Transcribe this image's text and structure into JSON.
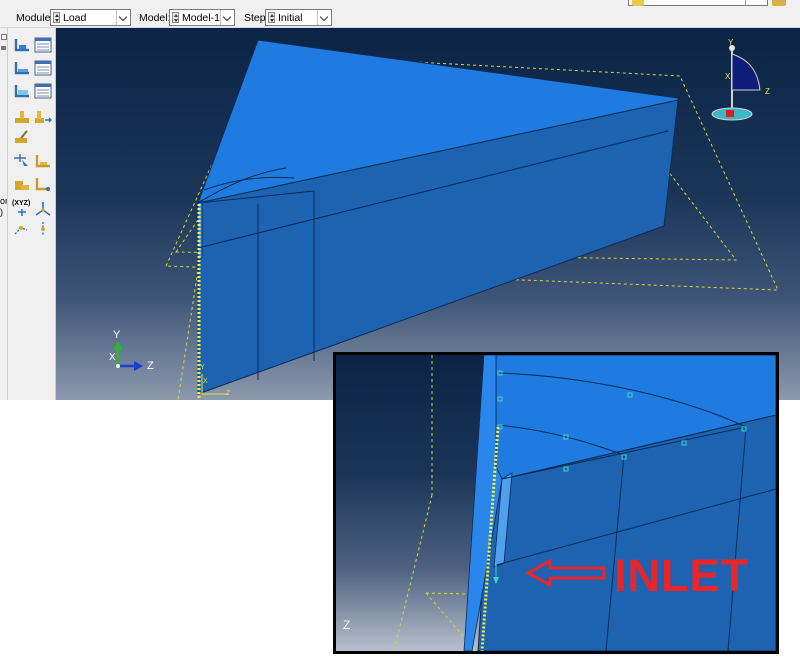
{
  "context_bar": {
    "module": {
      "label": "Module:",
      "value": "Load"
    },
    "model": {
      "label": "Model:",
      "value": "Model-1"
    },
    "step": {
      "label": "Step:",
      "value": "Initial"
    }
  },
  "left_strip_fragments": [
    "or",
    ")"
  ],
  "toolbox": {
    "xyz_tool_label": "(XYZ)"
  },
  "viewport": {
    "triad": {
      "x": "X",
      "y": "Y",
      "z": "Z"
    },
    "view_cube": {
      "y": "Y",
      "x": "X",
      "z": "Z"
    },
    "model_axes": {
      "x": "X",
      "y": "Y",
      "z": "Z"
    }
  },
  "zoom_inset": {
    "annotation": "INLET",
    "z_label": "Z"
  },
  "colors": {
    "part_top": "#1f7be0",
    "part_side": "#1d63b2",
    "datum_line": "#d6d63a",
    "inlet_red": "#e8262a",
    "triad_y": "#2db62d",
    "triad_z": "#1a3fd0"
  }
}
